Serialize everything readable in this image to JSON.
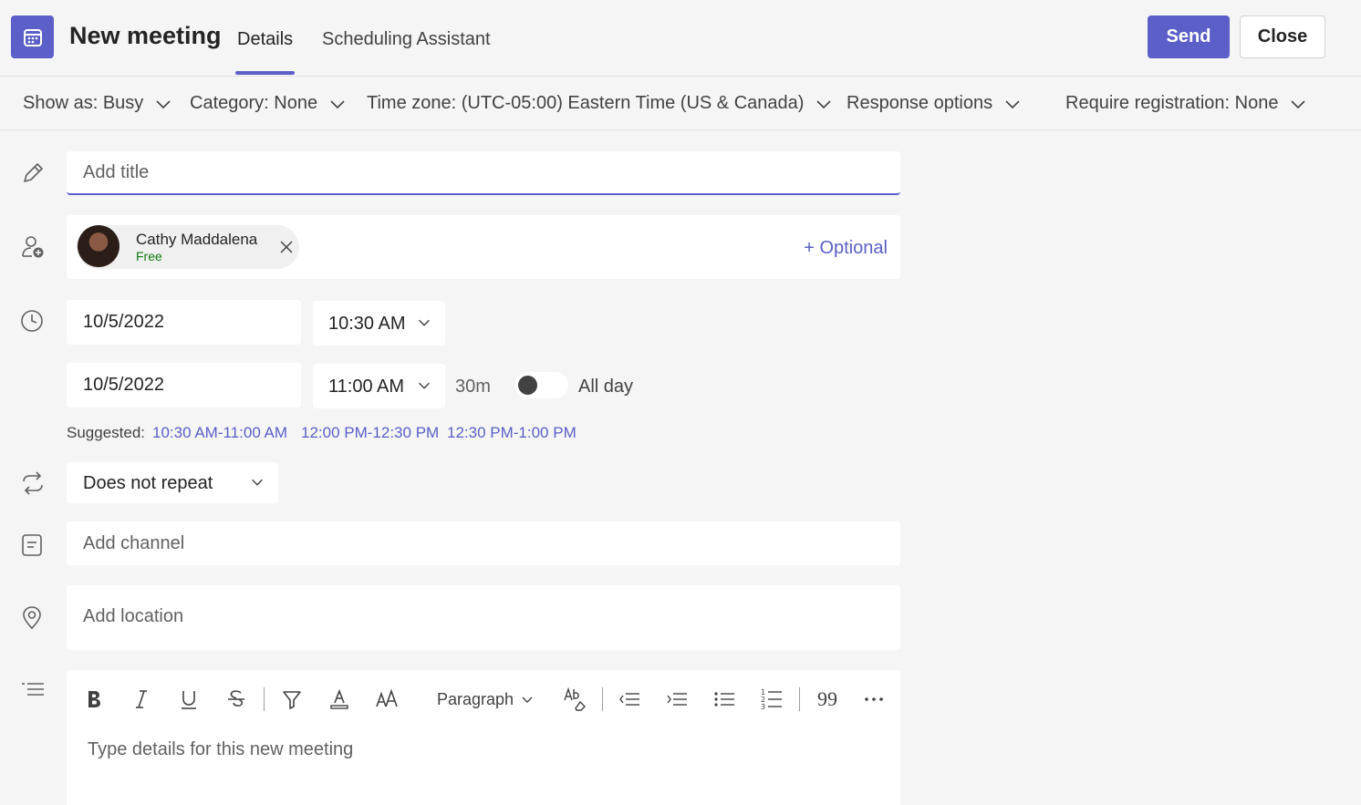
{
  "header": {
    "app_icon": "calendar-icon",
    "title": "New meeting",
    "tabs": [
      {
        "label": "Details",
        "active": true
      },
      {
        "label": "Scheduling Assistant",
        "active": false
      }
    ],
    "send_label": "Send",
    "close_label": "Close",
    "accent_color": "#5b5fc7"
  },
  "options": [
    {
      "label": "Show as: Busy"
    },
    {
      "label": "Category: None"
    },
    {
      "label": "Time zone: (UTC-05:00) Eastern Time (US & Canada)"
    },
    {
      "label": "Response options"
    },
    {
      "label": "Require registration: None"
    }
  ],
  "form": {
    "title_placeholder": "Add title",
    "attendee": {
      "name": "Cathy Maddalena",
      "status": "Free"
    },
    "optional_label": "+ Optional",
    "start_date": "10/5/2022",
    "start_time": "10:30 AM",
    "end_date": "10/5/2022",
    "end_time": "11:00 AM",
    "duration": "30m",
    "all_day_label": "All day",
    "all_day_on": false,
    "suggested_label": "Suggested:",
    "suggestions": [
      "10:30 AM-11:00 AM",
      "12:00 PM-12:30 PM",
      "12:30 PM-1:00 PM"
    ],
    "repeat": "Does not repeat",
    "channel_placeholder": "Add channel",
    "location_placeholder": "Add location",
    "editor": {
      "paragraph_label": "Paragraph",
      "quote_label": "99",
      "placeholder": "Type details for this new meeting"
    }
  }
}
